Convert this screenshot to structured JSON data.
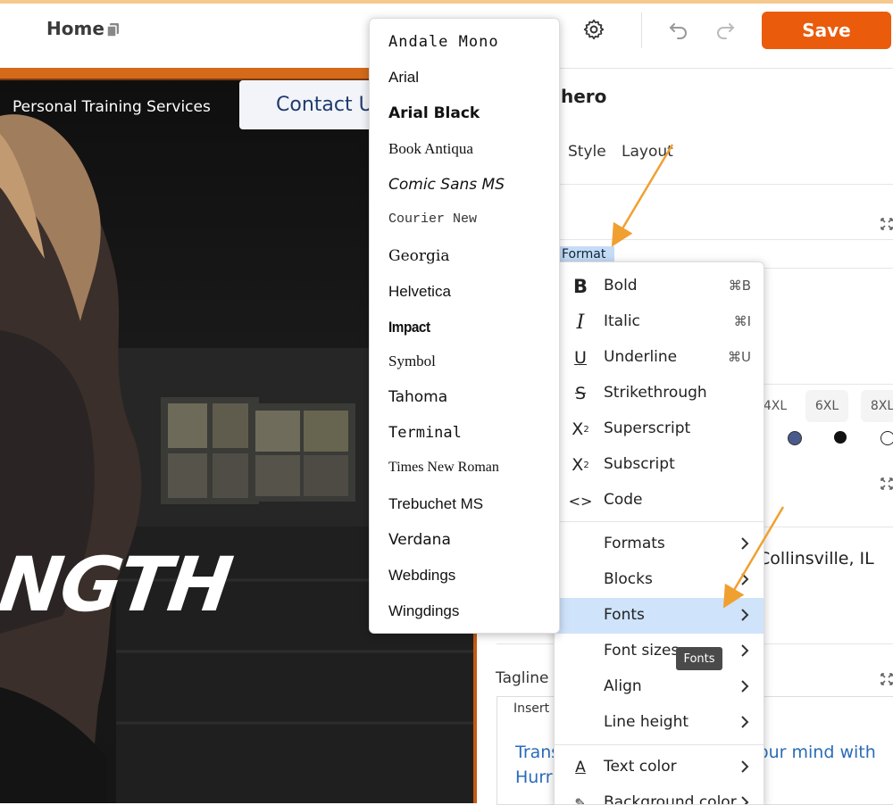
{
  "header": {
    "title": "Home",
    "save_label": "Save"
  },
  "preview": {
    "nav_text": "Personal Training Services",
    "contact_button": "Contact Us",
    "headline_fragment": "NGTH"
  },
  "panel": {
    "title_fragment": "hero",
    "tabs": [
      "Style",
      "Layout"
    ],
    "format_tag": "Format",
    "size_chips": [
      "4XL",
      "6XL",
      "8XL"
    ],
    "location_text": "Collinsville, IL",
    "tagline_label": "Tagline",
    "insert_tab": "Insert",
    "tagline_text_left_1": "Trans",
    "tagline_text_left_2": "Hurr",
    "tagline_text_right": "our mind with"
  },
  "fonts_menu": {
    "items": [
      "Andale Mono",
      "Arial",
      "Arial Black",
      "Book Antiqua",
      "Comic Sans MS",
      "Courier New",
      "Georgia",
      "Helvetica",
      "Impact",
      "Symbol",
      "Tahoma",
      "Terminal",
      "Times New Roman",
      "Trebuchet MS",
      "Verdana",
      "Webdings",
      "Wingdings"
    ]
  },
  "format_menu": {
    "items": [
      {
        "label": "Bold",
        "shortcut": "⌘B",
        "icon": "bold-icon"
      },
      {
        "label": "Italic",
        "shortcut": "⌘I",
        "icon": "italic-icon"
      },
      {
        "label": "Underline",
        "shortcut": "⌘U",
        "icon": "underline-icon"
      },
      {
        "label": "Strikethrough",
        "shortcut": "",
        "icon": "strikethrough-icon"
      },
      {
        "label": "Superscript",
        "shortcut": "",
        "icon": "superscript-icon"
      },
      {
        "label": "Subscript",
        "shortcut": "",
        "icon": "subscript-icon"
      },
      {
        "label": "Code",
        "shortcut": "",
        "icon": "code-icon"
      }
    ],
    "submenus": [
      "Formats",
      "Blocks",
      "Fonts",
      "Font sizes",
      "Align",
      "Line height"
    ],
    "color_items": [
      "Text color",
      "Background color"
    ],
    "active": "Fonts"
  },
  "tooltip": "Fonts",
  "colors": {
    "accent": "#ea5b0c",
    "highlight": "#cfe3fb",
    "annotation_arrow": "#f0a030"
  }
}
